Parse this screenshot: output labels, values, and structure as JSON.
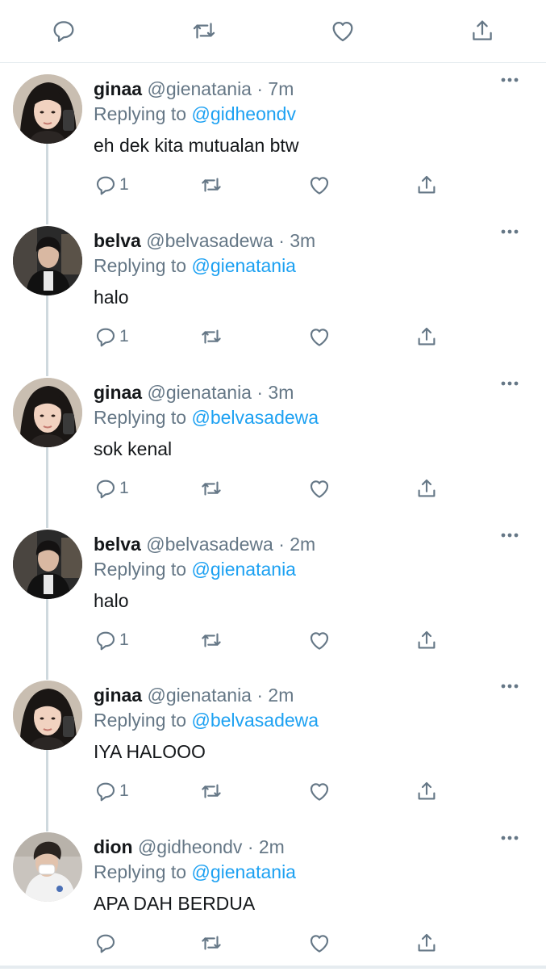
{
  "colors": {
    "accent": "#1da1f2",
    "muted": "#657786",
    "text": "#14171a",
    "thread": "#cfd9de"
  },
  "top_actions": [
    "reply-icon",
    "retweet-icon",
    "like-icon",
    "share-icon"
  ],
  "replying_to_label": "Replying to",
  "tweets": [
    {
      "name": "ginaa",
      "handle": "@gienatania",
      "time": "· 7m",
      "replying_to": "@gidheondv",
      "text": "eh dek kita mutualan btw",
      "reply_count": "1",
      "avatar": "ginaa-avatar"
    },
    {
      "name": "belva",
      "handle": "@belvasadewa",
      "time": "· 3m",
      "replying_to": "@gienatania",
      "text": "halo",
      "reply_count": "1",
      "avatar": "belva-avatar"
    },
    {
      "name": "ginaa",
      "handle": "@gienatania",
      "time": "· 3m",
      "replying_to": "@belvasadewa",
      "text": "sok kenal",
      "reply_count": "1",
      "avatar": "ginaa-avatar"
    },
    {
      "name": "belva",
      "handle": "@belvasadewa",
      "time": "· 2m",
      "replying_to": "@gienatania",
      "text": "halo",
      "reply_count": "1",
      "avatar": "belva-avatar"
    },
    {
      "name": "ginaa",
      "handle": "@gienatania",
      "time": "· 2m",
      "replying_to": "@belvasadewa",
      "text": "IYA HALOOO",
      "reply_count": "1",
      "avatar": "ginaa-avatar"
    },
    {
      "name": "dion",
      "handle": "@gidheondv",
      "time": "· 2m",
      "replying_to": "@gienatania",
      "text": "APA DAH BERDUA",
      "reply_count": "",
      "avatar": "dion-avatar"
    }
  ]
}
